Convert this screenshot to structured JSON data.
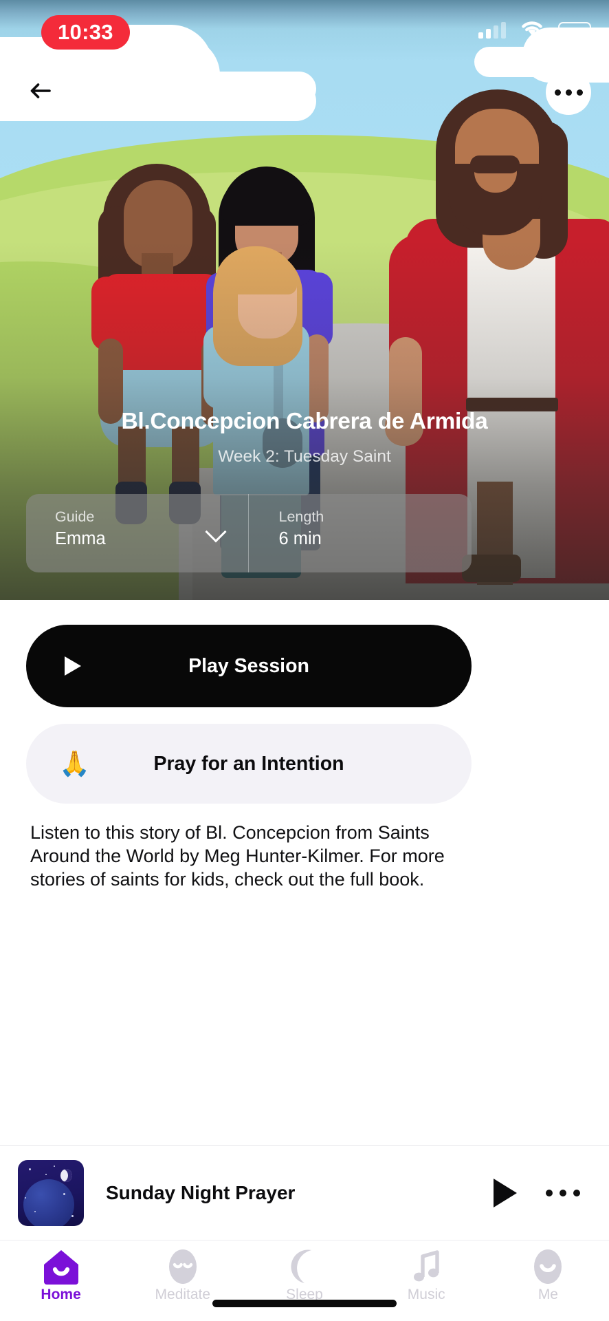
{
  "status_bar": {
    "time": "10:33",
    "time_pill_color": "#f42b3a",
    "signal_icon": "cellular-signal-icon",
    "wifi_icon": "wifi-icon",
    "battery_icon": "battery-low-power-icon",
    "battery_fill_color": "#f7d000"
  },
  "hero": {
    "back_icon": "back-arrow-icon",
    "more_icon": "more-options-icon",
    "title": "Bl.Concepcion Cabrera de Armida",
    "subtitle": "Week 2: Tuesday Saint",
    "selector": {
      "guide": {
        "label": "Guide",
        "value": "Emma",
        "chevron_icon": "chevron-down-icon"
      },
      "length": {
        "label": "Length",
        "value": "6 min"
      }
    }
  },
  "actions": {
    "play": {
      "label": "Play Session",
      "icon": "play-icon",
      "background": "#080808",
      "text_color": "#ffffff"
    },
    "pray": {
      "label": "Pray for an Intention",
      "icon": "praying-hands-icon",
      "glyph": "🙏",
      "background": "#f3f2f7",
      "text_color": "#0b0b0d"
    }
  },
  "description": "Listen to this story of Bl. Concepcion from Saints Around the World by Meg Hunter-Kilmer. For more stories of saints for kids, check out the full book.",
  "mini_player": {
    "title": "Sunday Night Prayer",
    "thumbnail_icon": "night-sky-earth-thumbnail",
    "play_icon": "play-icon",
    "more_icon": "more-options-icon"
  },
  "tab_bar": {
    "active_color": "#7b10d8",
    "inactive_color": "#d0ced6",
    "items": [
      {
        "label": "Home",
        "icon": "home-icon",
        "active": true
      },
      {
        "label": "Meditate",
        "icon": "meditate-face-icon",
        "active": false
      },
      {
        "label": "Sleep",
        "icon": "moon-icon",
        "active": false
      },
      {
        "label": "Music",
        "icon": "music-note-icon",
        "active": false
      },
      {
        "label": "Me",
        "icon": "profile-face-icon",
        "active": false
      }
    ]
  }
}
